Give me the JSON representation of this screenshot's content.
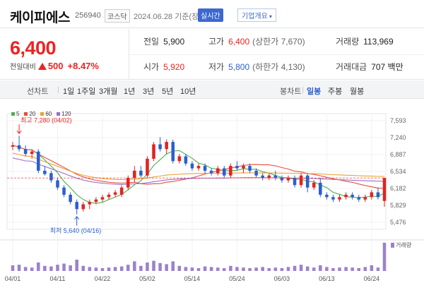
{
  "header": {
    "name": "케이피에스",
    "code": "256940",
    "market": "코스닥",
    "as_of": "2024.06.28 기준(장마감)",
    "live_label": "실시간",
    "company_label": "기업개요"
  },
  "quote": {
    "price": "6,400",
    "change_label": "전일대비",
    "change": "500",
    "change_pct": "+8.47%",
    "prev_close_label": "전일",
    "prev_close": "5,900",
    "high_label": "고가",
    "high": "6,400",
    "high_note": "(상한가 7,670)",
    "volume_label": "거래량",
    "volume": "113,969",
    "open_label": "시가",
    "open": "5,920",
    "low_label": "저가",
    "low": "5,800",
    "low_note": "(하한가 4,130)",
    "amount_label": "거래대금",
    "amount": "707 백만"
  },
  "colors": {
    "up": "#e22222",
    "down": "#2b5fd0"
  },
  "periods": {
    "title": "선차트",
    "items": [
      "1일",
      "1주일",
      "3개월",
      "1년",
      "3년",
      "5년",
      "10년"
    ]
  },
  "candle": {
    "title": "봉차트",
    "items": [
      "일봉",
      "주봉",
      "월봉"
    ],
    "active": "일봉"
  },
  "chart_data": {
    "type": "candlestick",
    "legend": [
      {
        "name": "5",
        "color": "#4caf50"
      },
      {
        "name": "20",
        "color": "#e84c3d"
      },
      {
        "name": "60",
        "color": "#f0a030"
      },
      {
        "name": "120",
        "color": "#9c6fc8"
      }
    ],
    "y_ticks": [
      "7,593",
      "7,240",
      "6,887",
      "6,534",
      "6,182",
      "5,829",
      "5,476"
    ],
    "ylim": [
      5476,
      7593
    ],
    "x_labels": [
      "04/01",
      "04/11",
      "04/22",
      "05/02",
      "05/14",
      "05/24",
      "06/03",
      "06/13",
      "06/24"
    ],
    "x_label_index": [
      0,
      7,
      14,
      21,
      28,
      35,
      42,
      49,
      56
    ],
    "max_annotation": "최고 7,280 (04/02)",
    "min_annotation": "최저 5,640 (04/16)",
    "volume_label": "거래량",
    "candles": [
      [
        7050,
        7150,
        6980,
        7080
      ],
      [
        7080,
        7280,
        6950,
        7000
      ],
      [
        7000,
        7080,
        6850,
        6900
      ],
      [
        6900,
        7000,
        6800,
        6950
      ],
      [
        6950,
        7000,
        6500,
        6550
      ],
      [
        6550,
        6650,
        6450,
        6480
      ],
      [
        6500,
        6550,
        6300,
        6350
      ],
      [
        6350,
        6400,
        6150,
        6200
      ],
      [
        6200,
        6250,
        6000,
        6050
      ],
      [
        6050,
        6100,
        5850,
        5900
      ],
      [
        5900,
        5950,
        5640,
        5750
      ],
      [
        5750,
        5900,
        5700,
        5850
      ],
      [
        5850,
        5950,
        5750,
        5900
      ],
      [
        5900,
        6000,
        5850,
        5950
      ],
      [
        5950,
        6050,
        5900,
        6000
      ],
      [
        6000,
        6100,
        5950,
        6050
      ],
      [
        6050,
        6150,
        6000,
        6100
      ],
      [
        6050,
        6250,
        6000,
        6200
      ],
      [
        6200,
        6450,
        6150,
        6400
      ],
      [
        6400,
        6650,
        6300,
        6550
      ],
      [
        6550,
        6650,
        6400,
        6450
      ],
      [
        6450,
        6850,
        6400,
        6800
      ],
      [
        6800,
        7150,
        6750,
        7100
      ],
      [
        7100,
        7250,
        6950,
        7000
      ],
      [
        7000,
        7200,
        6900,
        7150
      ],
      [
        7150,
        7200,
        6700,
        6750
      ],
      [
        6750,
        6900,
        6700,
        6850
      ],
      [
        6850,
        6900,
        6650,
        6700
      ],
      [
        6700,
        6750,
        6550,
        6600
      ],
      [
        6600,
        6700,
        6550,
        6650
      ],
      [
        6650,
        6700,
        6500,
        6550
      ],
      [
        6550,
        6600,
        6450,
        6500
      ],
      [
        6500,
        6650,
        6450,
        6600
      ],
      [
        6600,
        6650,
        6400,
        6450
      ],
      [
        6450,
        6700,
        6400,
        6650
      ],
      [
        6650,
        6750,
        6550,
        6600
      ],
      [
        6600,
        6700,
        6500,
        6650
      ],
      [
        6650,
        6700,
        6500,
        6550
      ],
      [
        6550,
        6600,
        6400,
        6450
      ],
      [
        6450,
        6500,
        6350,
        6400
      ],
      [
        6400,
        6500,
        6350,
        6450
      ],
      [
        6450,
        6550,
        6350,
        6400
      ],
      [
        6400,
        6450,
        6300,
        6350
      ],
      [
        6350,
        6450,
        6300,
        6400
      ],
      [
        6400,
        6450,
        6200,
        6250
      ],
      [
        6250,
        6500,
        6200,
        6450
      ],
      [
        6450,
        6500,
        6100,
        6200
      ],
      [
        6200,
        6350,
        6150,
        6300
      ],
      [
        6300,
        6400,
        6000,
        6050
      ],
      [
        6050,
        6100,
        5950,
        6000
      ],
      [
        6000,
        6050,
        5900,
        5950
      ],
      [
        5950,
        6050,
        5900,
        6000
      ],
      [
        6000,
        6100,
        5950,
        6050
      ],
      [
        6050,
        6100,
        5950,
        6000
      ],
      [
        6000,
        6050,
        5900,
        5950
      ],
      [
        5950,
        6050,
        5900,
        6000
      ],
      [
        6000,
        6150,
        5950,
        6100
      ],
      [
        6100,
        6200,
        5950,
        6000
      ],
      [
        5920,
        6400,
        5800,
        6400
      ]
    ],
    "volumes": [
      20,
      22,
      14,
      12,
      30,
      18,
      16,
      22,
      26,
      20,
      40,
      18,
      14,
      12,
      10,
      12,
      14,
      16,
      22,
      34,
      18,
      30,
      36,
      28,
      24,
      34,
      18,
      14,
      12,
      10,
      16,
      14,
      12,
      10,
      18,
      14,
      12,
      10,
      12,
      14,
      10,
      12,
      10,
      14,
      18,
      22,
      16,
      12,
      20,
      14,
      10,
      12,
      14,
      12,
      10,
      14,
      20,
      12,
      100
    ]
  }
}
